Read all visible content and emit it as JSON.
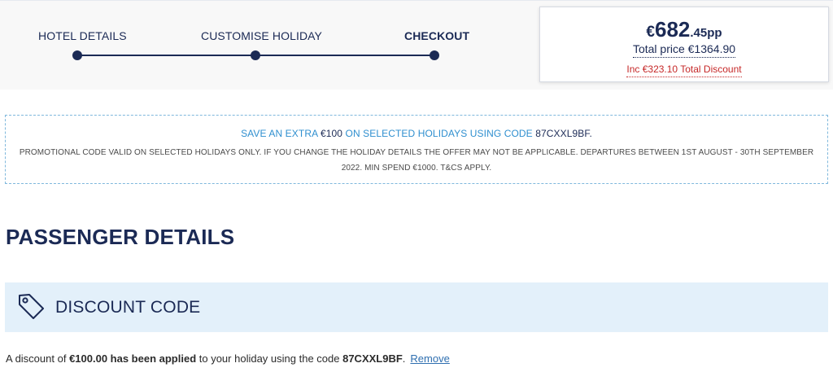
{
  "steps": [
    {
      "label": "HOTEL DETAILS",
      "active": false
    },
    {
      "label": "CUSTOMISE HOLIDAY",
      "active": false
    },
    {
      "label": "CHECKOUT",
      "active": true
    }
  ],
  "price": {
    "currency": "€",
    "integer": "682",
    "decimal": ".45pp",
    "total": "Total price €1364.90",
    "discount": "Inc €323.10 Total Discount"
  },
  "promo": {
    "headline_pre": "SAVE AN EXTRA ",
    "headline_amount": "€100",
    "headline_mid": " ON SELECTED HOLIDAYS USING CODE ",
    "headline_code": "87CXXL9BF.",
    "body": "PROMOTIONAL CODE VALID ON SELECTED HOLIDAYS ONLY. IF YOU CHANGE THE HOLIDAY DETAILS THE OFFER MAY NOT BE APPLICABLE. DEPARTURES BETWEEN 1ST AUGUST - 30TH SEPTEMBER 2022. MIN SPEND €1000. T&CS APPLY."
  },
  "page_title": "PASSENGER DETAILS",
  "discount": {
    "title": "DISCOUNT CODE",
    "icon": "tag-icon",
    "msg_pre": "A discount of ",
    "msg_amount": "€100.00 has been applied",
    "msg_mid": " to your holiday using the code ",
    "msg_code": "87CXXL9BF",
    "msg_end": ".",
    "remove_label": "Remove"
  },
  "colors": {
    "navy": "#1b2a55",
    "promo_blue": "#2f8fcf",
    "discount_red": "#c62828",
    "panel_blue": "#e3f0fa",
    "link": "#2f6fb0"
  }
}
